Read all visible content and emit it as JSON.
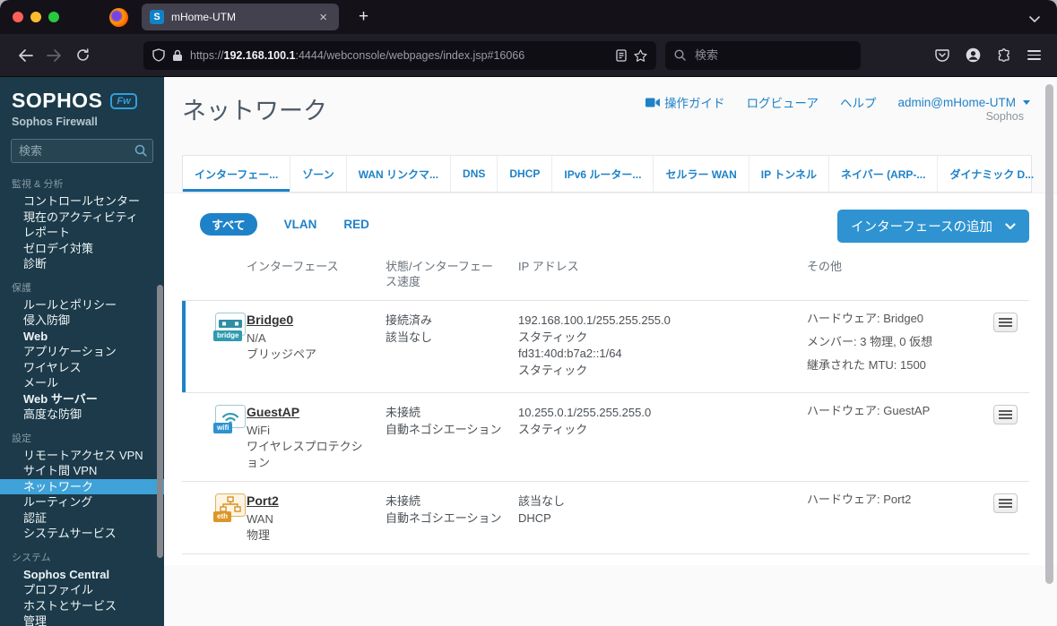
{
  "browser": {
    "tab_title": "mHome-UTM",
    "favicon_letter": "S",
    "url_scheme": "https://",
    "url_host": "192.168.100.1",
    "url_path": ":4444/webconsole/webpages/index.jsp#16066",
    "search_placeholder": "検索"
  },
  "sidebar": {
    "logo": "SOPHOS",
    "logo_badge": "Fw",
    "product": "Sophos Firewall",
    "search_placeholder": "検索",
    "sections": [
      {
        "title": "監視 & 分析",
        "items": [
          "コントロールセンター",
          "現在のアクティビティ",
          "レポート",
          "ゼロデイ対策",
          "診断"
        ]
      },
      {
        "title": "保護",
        "items": [
          "ルールとポリシー",
          "侵入防御",
          "Web",
          "アプリケーション",
          "ワイヤレス",
          "メール",
          "Web サーバー",
          "高度な防御"
        ]
      },
      {
        "title": "設定",
        "items": [
          "リモートアクセス VPN",
          "サイト間 VPN",
          "ネットワーク",
          "ルーティング",
          "認証",
          "システムサービス"
        ]
      },
      {
        "title": "システム",
        "items": [
          "Sophos Central",
          "プロファイル",
          "ホストとサービス",
          "管理"
        ]
      }
    ],
    "selected_item": "ネットワーク"
  },
  "header": {
    "title": "ネットワーク",
    "guide": "操作ガイド",
    "log_viewer": "ログビューア",
    "help": "ヘルプ",
    "user": "admin@mHome-UTM",
    "brand": "Sophos"
  },
  "tabs": [
    "インターフェー...",
    "ゾーン",
    "WAN リンクマ...",
    "DNS",
    "DHCP",
    "IPv6 ルーター...",
    "セルラー WAN",
    "IP トンネル",
    "ネイバー (ARP-...",
    "ダイナミック D..."
  ],
  "active_tab": "インターフェー...",
  "filters": {
    "all": "すべて",
    "vlan": "VLAN",
    "red": "RED"
  },
  "add_button": "インターフェースの追加",
  "table": {
    "headers": [
      "インターフェース",
      "状態/インターフェース速度",
      "IP アドレス",
      "その他"
    ],
    "rows": [
      {
        "name": "Bridge0",
        "badge": "bridge",
        "type": [
          "N/A",
          "ブリッジペア"
        ],
        "status": [
          "接続済み",
          "該当なし"
        ],
        "ip": [
          "192.168.100.1/255.255.255.0",
          "スタティック",
          "fd31:40d:b7a2::1/64",
          "スタティック"
        ],
        "other": [
          "ハードウェア: Bridge0",
          "メンバー: 3 物理, 0 仮想",
          "継承された MTU: 1500"
        ]
      },
      {
        "name": "GuestAP",
        "badge": "wifi",
        "type": [
          "WiFi",
          "ワイヤレスプロテクション"
        ],
        "status": [
          "未接続",
          "自動ネゴシエーション"
        ],
        "ip": [
          "10.255.0.1/255.255.255.0",
          "スタティック"
        ],
        "other": [
          "ハードウェア: GuestAP"
        ]
      },
      {
        "name": "Port2",
        "badge": "eth",
        "type": [
          "WAN",
          "物理"
        ],
        "status": [
          "未接続",
          "自動ネゴシエーション"
        ],
        "ip": [
          "該当なし",
          "DHCP"
        ],
        "other": [
          "ハードウェア: Port2"
        ]
      }
    ]
  },
  "colors": {
    "accent_blue": "#1e82c8",
    "button_blue": "#2e93d0",
    "sidebar_bg": "#1c3a49",
    "selected_blue": "#3fa2d9",
    "teal": "#2e9bb0",
    "eth_orange": "#dd9626"
  }
}
